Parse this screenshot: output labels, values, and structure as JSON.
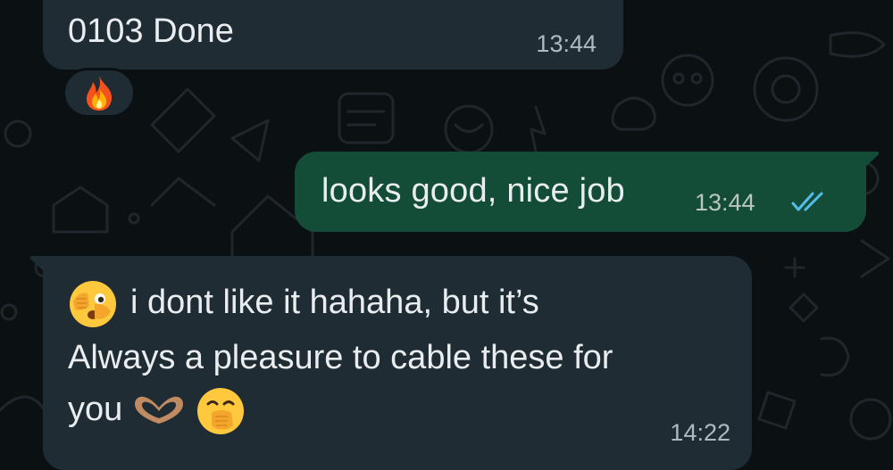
{
  "chat": {
    "messages": [
      {
        "direction": "incoming",
        "text": "0103 Done",
        "time": "13:44",
        "reaction": "fire-emoji"
      },
      {
        "direction": "outgoing",
        "text": "looks good, nice job",
        "time": "13:44",
        "status": "read"
      },
      {
        "direction": "incoming",
        "line1": "i dont like it hahaha, but it’s",
        "line2": "Always a pleasure to cable these for",
        "line3": "you",
        "time": "14:22",
        "emojis": [
          "face-with-peeking-eye-emoji",
          "heart-hands-emoji",
          "face-with-hand-over-mouth-emoji"
        ]
      }
    ]
  },
  "colors": {
    "background": "#0b1013",
    "incoming_bubble": "#1f2c33",
    "outgoing_bubble": "#144d37",
    "read_ticks": "#53bdeb"
  }
}
